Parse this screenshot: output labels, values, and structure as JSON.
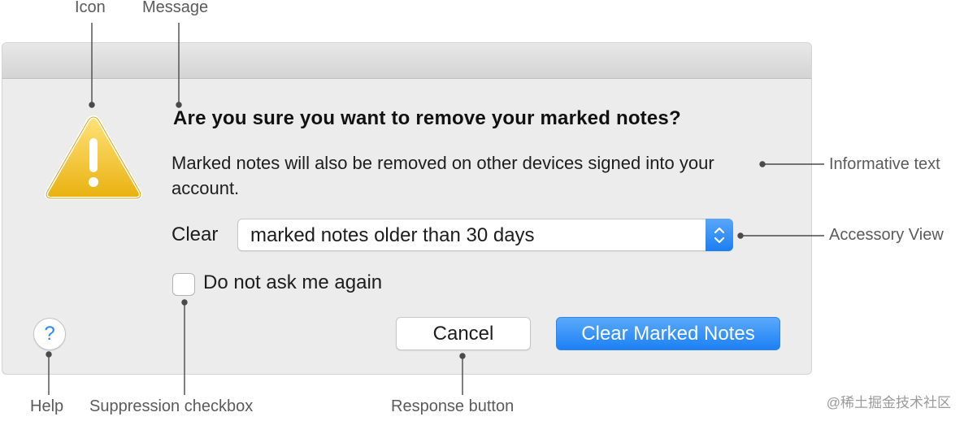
{
  "dialog": {
    "message": "Are you sure you want to remove your marked notes?",
    "informative_text": "Marked notes will also be removed on other devices signed into your account.",
    "accessory": {
      "label": "Clear",
      "selected_option": "marked notes older than 30 days"
    },
    "suppression_checkbox": {
      "label": "Do not ask me again",
      "checked": false
    },
    "help_label": "?",
    "buttons": {
      "cancel": "Cancel",
      "default": "Clear Marked Notes"
    },
    "accent_color": "#1c80f4",
    "icon": "warning-triangle-icon"
  },
  "callouts": {
    "icon": "Icon",
    "message": "Message",
    "informative_text": "Informative text",
    "accessory_view": "Accessory View",
    "help": "Help",
    "suppression_checkbox": "Suppression checkbox",
    "response_button": "Response button"
  },
  "watermark": "@稀土掘金技术社区"
}
